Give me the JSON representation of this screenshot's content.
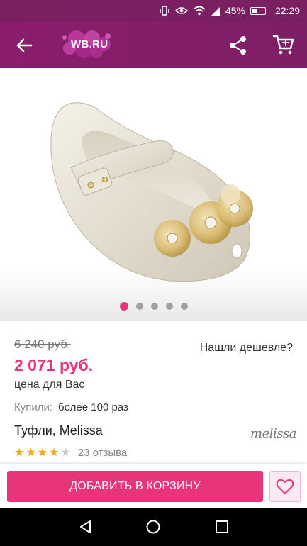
{
  "status_bar": {
    "battery": "45%",
    "time": "22:29"
  },
  "app_bar": {
    "logo_text": "WB.RU"
  },
  "gallery": {
    "slide_count": 5,
    "active_slide": 1
  },
  "product": {
    "old_price": "6 240 руб.",
    "cheaper_link": "Нашли дешевле?",
    "new_price": "2 071 руб.",
    "price_for_you": "цена для Вас",
    "bought_label": "Купили:",
    "bought_value": "более 100 раз",
    "title": "Туфли, Melissa",
    "brand_logo": "melissa",
    "rating": 4,
    "reviews": "23 отзыва"
  },
  "bottom": {
    "add_to_cart": "ДОБАВИТЬ В КОРЗИНУ"
  },
  "colors": {
    "brand": "#7b1f63",
    "accent": "#e8347a"
  },
  "icons": [
    "back-arrow-icon",
    "share-icon",
    "cart-icon",
    "heart-icon",
    "nav-back-icon",
    "nav-home-icon",
    "nav-recent-icon"
  ]
}
